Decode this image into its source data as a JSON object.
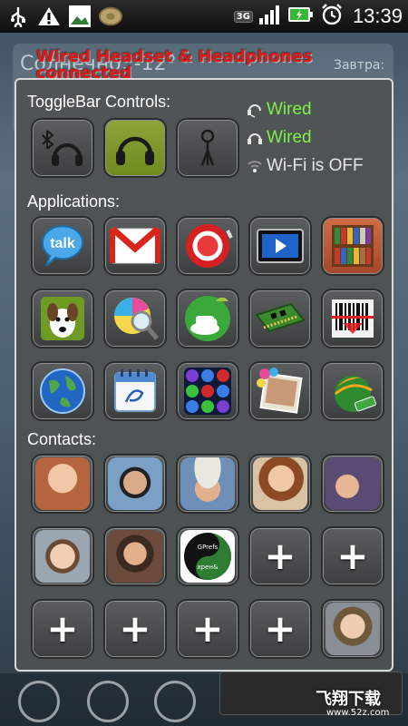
{
  "status_bar": {
    "time": "13:39",
    "network_badge_left": "3G",
    "network_badge_right": "3G",
    "icons": [
      "usb-icon",
      "warning-icon",
      "gallery-3g-icon",
      "tunes-icon",
      "signal-icon",
      "battery-icon",
      "alarm-icon"
    ]
  },
  "background": {
    "weather_text": "Солнечно, -12°",
    "tomorrow_label": "Завтра:"
  },
  "overlay_title": "Wired Headset & Headphones connected",
  "panel": {
    "togglebar_label": "ToggleBar Controls:",
    "applications_label": "Applications:",
    "contacts_label": "Contacts:"
  },
  "toggles": [
    {
      "name": "bluetooth-headset-toggle",
      "icon": "bluetooth-headphones-icon",
      "active": false
    },
    {
      "name": "wired-headphones-toggle",
      "icon": "headphones-icon",
      "active": true
    },
    {
      "name": "wifi-toggle",
      "icon": "wifi-antenna-icon",
      "active": false
    }
  ],
  "status_lines": [
    {
      "icon": "headset-icon",
      "text": "Wired",
      "color": "#7ef04a"
    },
    {
      "icon": "headphones-small-icon",
      "text": "Wired",
      "color": "#7ef04a"
    },
    {
      "icon": "wifi-off-icon",
      "text": "Wi-Fi is OFF",
      "color": "#e6e6e6"
    }
  ],
  "apps": [
    "talk-app-icon",
    "gmail-app-icon",
    "voice-recorder-app-icon",
    "video-player-app-icon",
    "book-shelf-app-icon",
    "dog-app-icon",
    "color-picker-app-icon",
    "android-coffee-app-icon",
    "memory-card-app-icon",
    "barcode-scanner-app-icon",
    "globe-app-icon",
    "calendar-app-icon",
    "bubbles-game-app-icon",
    "photo-app-icon",
    "mini-browser-app-icon"
  ],
  "talk_label": "talk",
  "contacts": [
    {
      "type": "photo",
      "name": "contact-photo-1",
      "color": "#b5653f"
    },
    {
      "type": "photo",
      "name": "contact-photo-2",
      "color": "#7aa0c6"
    },
    {
      "type": "photo",
      "name": "contact-photo-3",
      "color": "#6d8fb8"
    },
    {
      "type": "photo",
      "name": "contact-photo-4",
      "color": "#b47b52"
    },
    {
      "type": "photo",
      "name": "contact-photo-5",
      "color": "#5b4a73"
    },
    {
      "type": "photo",
      "name": "contact-photo-6",
      "color": "#9aa7b3"
    },
    {
      "type": "photo",
      "name": "contact-photo-7",
      "color": "#6d4b3c"
    },
    {
      "type": "logo",
      "name": "contact-logo-8",
      "color": "#ffffff"
    },
    {
      "type": "add",
      "name": "add-contact-9"
    },
    {
      "type": "add",
      "name": "add-contact-10"
    },
    {
      "type": "add",
      "name": "add-contact-11"
    },
    {
      "type": "add",
      "name": "add-contact-12"
    },
    {
      "type": "add",
      "name": "add-contact-13"
    },
    {
      "type": "add",
      "name": "add-contact-14"
    },
    {
      "type": "photo",
      "name": "contact-photo-15",
      "color": "#8a8f95"
    }
  ],
  "add_symbol": "+",
  "logo_text_top": "GPrefs",
  "logo_text_bottom": "хрен&",
  "watermark": "飞翔下载",
  "watermark_sub": "www.52z.com"
}
